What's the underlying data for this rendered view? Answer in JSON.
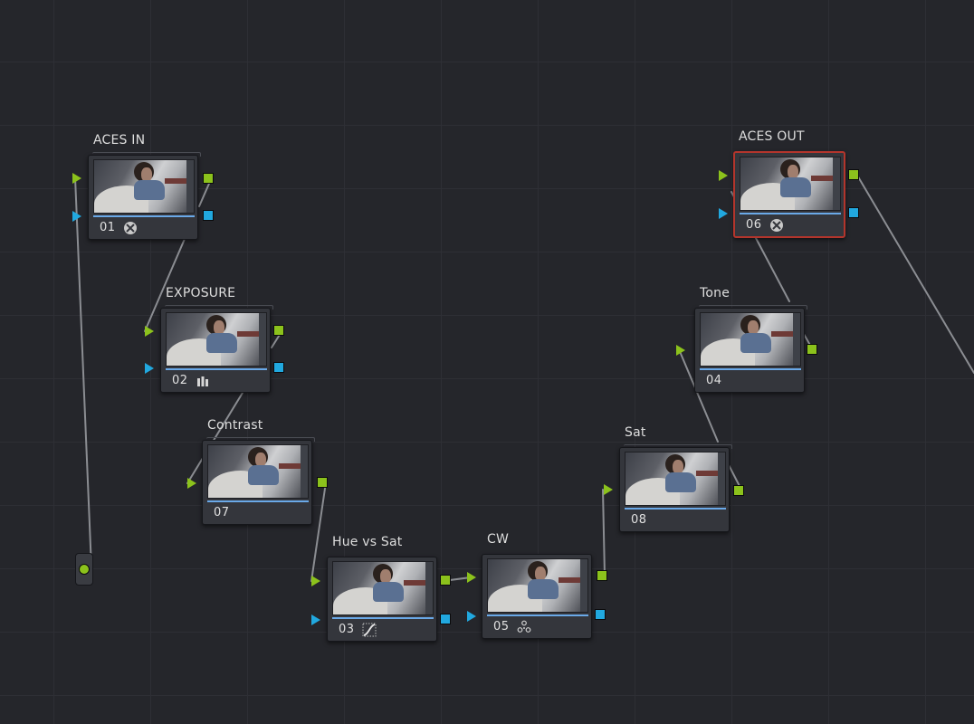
{
  "accent_colors": {
    "rgb_link": "#8cc21c",
    "alpha_link": "#21a8df",
    "selected_border": "#b3352c"
  },
  "nodes": [
    {
      "label": "ACES IN",
      "number": "01",
      "icon": "aces-transform-icon"
    },
    {
      "label": "EXPOSURE",
      "number": "02",
      "icon": "color-bars-icon"
    },
    {
      "label": "Contrast",
      "number": "07",
      "icon": ""
    },
    {
      "label": "Hue vs Sat",
      "number": "03",
      "icon": "curves-icon"
    },
    {
      "label": "CW",
      "number": "05",
      "icon": "color-wheels-icon"
    },
    {
      "label": "Sat",
      "number": "08",
      "icon": ""
    },
    {
      "label": "Tone",
      "number": "04",
      "icon": ""
    },
    {
      "label": "ACES OUT",
      "number": "06",
      "icon": "aces-transform-icon",
      "selected": true
    }
  ]
}
